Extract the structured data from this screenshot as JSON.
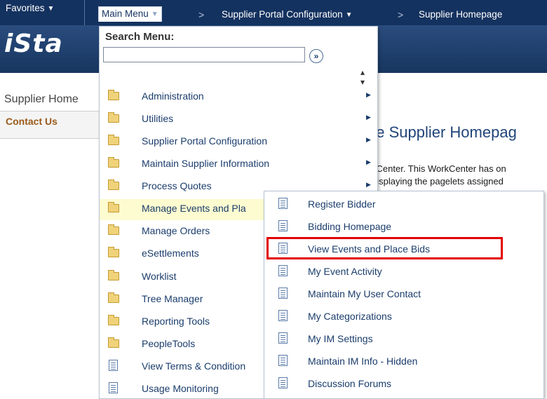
{
  "nav": {
    "favorites": "Favorites",
    "main_menu": "Main Menu",
    "breadcrumb_sep": ">",
    "supplier_portal_config": "Supplier Portal Configuration",
    "supplier_homepage": "Supplier Homepage"
  },
  "banner": {
    "logo": "iSta"
  },
  "page": {
    "label": "Supplier Home",
    "left_nav": {
      "contact_us": "Contact Us"
    },
    "heading": "ne Supplier Homepag",
    "text_line1": "kCenter. This WorkCenter has on",
    "text_line2": "displaying the pagelets assigned"
  },
  "menu": {
    "search_label": "Search Menu:",
    "search_value": "",
    "search_go": "»",
    "items": [
      {
        "label": "Administration",
        "type": "folder",
        "has_arrow": true
      },
      {
        "label": "Utilities",
        "type": "folder",
        "has_arrow": true
      },
      {
        "label": "Supplier Portal Configuration",
        "type": "folder",
        "has_arrow": true
      },
      {
        "label": "Maintain Supplier Information",
        "type": "folder",
        "has_arrow": true
      },
      {
        "label": "Process Quotes",
        "type": "folder",
        "has_arrow": true
      },
      {
        "label": "Manage Events and Pla",
        "type": "folder",
        "has_arrow": false
      },
      {
        "label": "Manage Orders",
        "type": "folder",
        "has_arrow": false
      },
      {
        "label": "eSettlements",
        "type": "folder",
        "has_arrow": false
      },
      {
        "label": "Worklist",
        "type": "folder",
        "has_arrow": false
      },
      {
        "label": "Tree Manager",
        "type": "folder",
        "has_arrow": false
      },
      {
        "label": "Reporting Tools",
        "type": "folder",
        "has_arrow": false
      },
      {
        "label": "PeopleTools",
        "type": "folder",
        "has_arrow": false
      },
      {
        "label": "View Terms & Condition",
        "type": "page",
        "has_arrow": false
      },
      {
        "label": "Usage Monitoring",
        "type": "page",
        "has_arrow": false
      }
    ]
  },
  "submenu": {
    "items": [
      {
        "label": "Register Bidder"
      },
      {
        "label": "Bidding Homepage"
      },
      {
        "label": "View Events and Place Bids"
      },
      {
        "label": "My Event Activity"
      },
      {
        "label": "Maintain My User Contact"
      },
      {
        "label": "My Categorizations"
      },
      {
        "label": "My IM Settings"
      },
      {
        "label": "Maintain IM Info - Hidden"
      },
      {
        "label": "Discussion Forums"
      }
    ]
  },
  "colors": {
    "nav_bg": "#14325f",
    "link": "#1b3d6c",
    "hover_bg": "#fdfbd0",
    "highlight": "#e10000",
    "contact": "#9a5a1a"
  }
}
